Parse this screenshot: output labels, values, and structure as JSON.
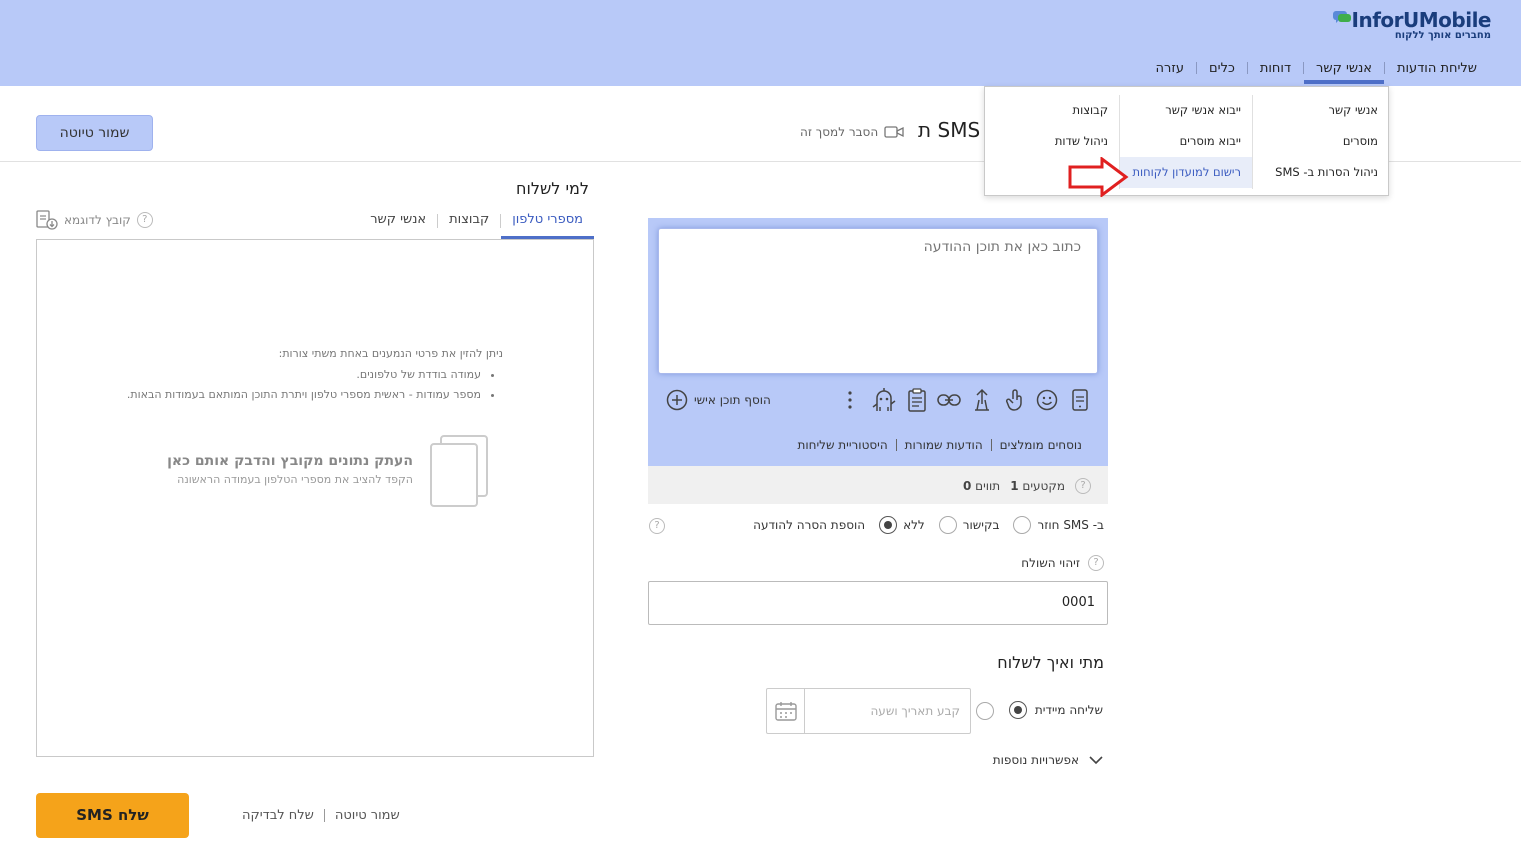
{
  "logo": {
    "brand_prefix": "InforU",
    "brand_suffix": "Mobile",
    "tagline": "מחברים אותך ללקוח"
  },
  "nav": {
    "items": [
      {
        "label": "שליחת הודעות"
      },
      {
        "label": "אנשי קשר"
      },
      {
        "label": "דוחות"
      },
      {
        "label": "כלים"
      },
      {
        "label": "עזרה"
      }
    ]
  },
  "dropdown": {
    "col1": [
      "אנשי קשר",
      "מוסרים",
      "ניהול הסרות ב- SMS"
    ],
    "col2": [
      "ייבוא אנשי קשר",
      "ייבוא מוסרים",
      "רישום למועדון לקוחות"
    ],
    "col3": [
      "קבוצות",
      "ניהול שדות"
    ]
  },
  "header": {
    "save_draft": "שמור טיוטה",
    "title": "SMS ת",
    "screen_help": "הסבר למסך זה"
  },
  "recipients": {
    "title": "למי לשלוח",
    "tabs": [
      "מספרי טלפון",
      "קבוצות",
      "אנשי קשר"
    ],
    "example_file": "קובץ לדוגמא",
    "intro": "ניתן להזין את פרטי הנמענים באחת משתי צורות:",
    "bullets": [
      "עמודה בודדת של טלפונים.",
      "מספר עמודות - ראשית מספרי טלפון ויתרת התוכן המותאם בעמודות הבאות."
    ],
    "paste_main": "העתק נתונים מקובץ והדבק אותם כאן",
    "paste_sub": "הקפד להציב את מספרי הטלפון בעמודה הראשונה"
  },
  "message": {
    "placeholder": "כתוב כאן את תוכן ההודעה",
    "add_personal": "הוסף תוכן אישי",
    "links": [
      "היסטוריית שליחות",
      "הודעות שמורות",
      "נוסחים מומלצים"
    ],
    "chars_label": "תווים",
    "chars_value": "0",
    "segments_label": "מקטעים",
    "segments_value": "1",
    "toolbar_icons": [
      "phone-preview-icon",
      "emoji-icon",
      "touch-icon",
      "upload-icon",
      "link-icon",
      "clipboard-icon",
      "robot-icon",
      "more-icon"
    ]
  },
  "optout": {
    "label": "הוספת הסרה להודעה",
    "options": [
      "ללא",
      "בקישור",
      "ב- SMS חוזר"
    ],
    "selected": "ללא"
  },
  "sender": {
    "label": "זיהוי השולח",
    "value": "0001"
  },
  "when": {
    "title": "מתי ואיך לשלוח",
    "send_now": "שליחה מיידית",
    "schedule_placeholder": "קבע תאריך ושעה",
    "more_options": "אפשרויות נוספות"
  },
  "footer": {
    "send_sms": "שלח SMS",
    "send_test": "שלח לבדיקה",
    "save_draft": "שמור טיוטה"
  },
  "colors": {
    "header_bg": "#b8c9f8",
    "accent": "#4e6fc8",
    "send_button": "#f5a31a",
    "arrow": "#e02020"
  }
}
